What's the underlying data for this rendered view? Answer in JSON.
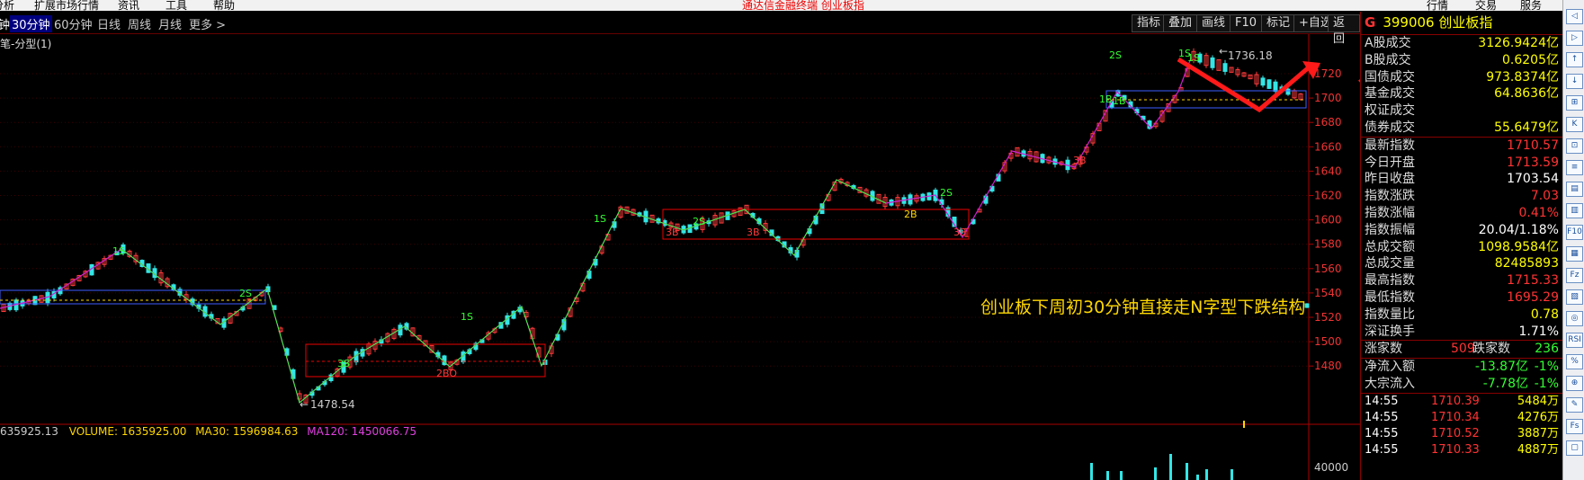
{
  "menubar": {
    "items": [
      "分析",
      "扩展市场行情",
      "资讯",
      "工具",
      "帮助"
    ],
    "notice": "通达信金融终端  创业板指",
    "right_items": [
      "行情",
      "交易",
      "服务"
    ]
  },
  "toolbar": {
    "periods": [
      "30分钟",
      "60分钟",
      "日线",
      "周线",
      "月线",
      "更多 >"
    ],
    "first_partial": "钟",
    "buttons": [
      "指标",
      "叠加",
      "画线",
      "F10",
      "标记",
      "+自选",
      "返回"
    ]
  },
  "chart": {
    "title": "笔-分型(1)",
    "annotation": "创业板下周初30分钟直接走N字型下跌结构",
    "high_label": "1736.18",
    "low_label": "1478.54",
    "price_axis": [
      "1720",
      "1700",
      "1680",
      "1660",
      "1640",
      "1620",
      "1600",
      "1580",
      "1560",
      "1540",
      "1520",
      "1500",
      "1480"
    ],
    "volume_axis": "40000",
    "markers": [
      "1S",
      "2S",
      "3S",
      "2BO",
      "1S",
      "1S",
      "3B",
      "2S",
      "3B",
      "2B",
      "2S",
      "3B",
      "1S",
      "2S",
      "1B",
      "3B",
      "1S",
      "1B"
    ]
  },
  "volume": {
    "prefix": "635925.13",
    "volume_text": "VOLUME: 1635925.00",
    "ma30_text": "MA30: 1596984.63",
    "ma120_text": "MA120: 1450066.75"
  },
  "side": {
    "g": "G",
    "code_name": "399006 创业板指",
    "rows": [
      {
        "label": "A股成交",
        "value": "3126.9424亿",
        "color": "#ffff00"
      },
      {
        "label": "B股成交",
        "value": "0.6205亿",
        "color": "#ffff00"
      },
      {
        "label": "国债成交",
        "value": "973.8374亿",
        "color": "#ffff00"
      },
      {
        "label": "基金成交",
        "value": "64.8636亿",
        "color": "#ffff00"
      },
      {
        "label": "权证成交",
        "value": "",
        "color": "#ffff00"
      },
      {
        "label": "债券成交",
        "value": "55.6479亿",
        "color": "#ffff00"
      }
    ],
    "rows2": [
      {
        "label": "最新指数",
        "value": "1710.57",
        "color": "#ff3333"
      },
      {
        "label": "今日开盘",
        "value": "1713.59",
        "color": "#ff3333"
      },
      {
        "label": "昨日收盘",
        "value": "1703.54",
        "color": "#ffffff"
      },
      {
        "label": "指数涨跌",
        "value": "7.03",
        "color": "#ff3333"
      },
      {
        "label": "指数涨幅",
        "value": "0.41%",
        "color": "#ff3333"
      },
      {
        "label": "指数振幅",
        "value": "20.04/1.18%",
        "color": "#ffffff"
      },
      {
        "label": "总成交额",
        "value": "1098.9584亿",
        "color": "#ffff00"
      },
      {
        "label": "总成交量",
        "value": "82485893",
        "color": "#ffff00"
      },
      {
        "label": "最高指数",
        "value": "1715.33",
        "color": "#ff3333"
      },
      {
        "label": "最低指数",
        "value": "1695.29",
        "color": "#ff3333"
      },
      {
        "label": "指数量比",
        "value": "0.78",
        "color": "#ffff00"
      },
      {
        "label": "深证换手",
        "value": "1.71%",
        "color": "#ffffff"
      }
    ],
    "updown": {
      "up_label": "涨家数",
      "up_value": "509",
      "down_label": "跌家数",
      "down_value": "236"
    },
    "flow": [
      {
        "label": "净流入额",
        "value": "-13.87亿",
        "pct": "-1%"
      },
      {
        "label": "大宗流入",
        "value": "-7.78亿",
        "pct": "-1%"
      }
    ],
    "ticks": [
      {
        "time": "14:55",
        "price": "1710.39",
        "vol": "5484万"
      },
      {
        "time": "14:55",
        "price": "1710.34",
        "vol": "4276万"
      },
      {
        "time": "14:55",
        "price": "1710.52",
        "vol": "3887万"
      },
      {
        "time": "14:55",
        "price": "1710.33",
        "vol": "4887万"
      }
    ]
  },
  "right_tools": [
    "◁",
    "▷",
    "↑",
    "↓",
    "⊞",
    "K",
    "⊡",
    "≡",
    "▤",
    "▥",
    "F10",
    "▦",
    "Fz",
    "▧",
    "◎",
    "RSI",
    "%",
    "⊕",
    "✎",
    "Fs",
    "▢"
  ]
}
